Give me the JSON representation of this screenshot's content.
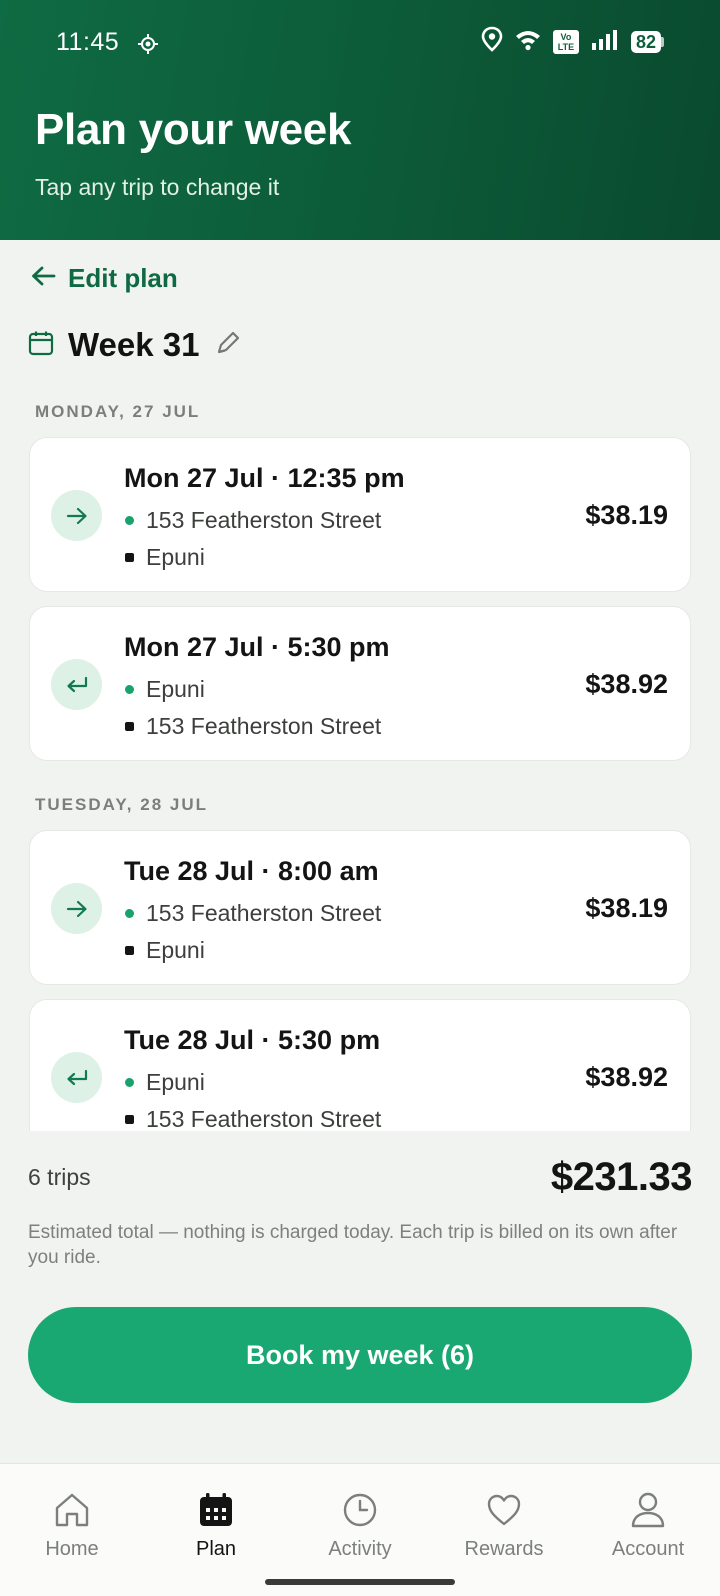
{
  "status_bar": {
    "time": "11:45",
    "battery": "82"
  },
  "header": {
    "title": "Plan your week",
    "subtitle": "Tap any trip to change it"
  },
  "back_link": {
    "label": "Edit plan"
  },
  "week": {
    "label": "Week 31"
  },
  "days": [
    {
      "heading": "MONDAY, 27 JUL"
    },
    {
      "heading": "TUESDAY, 28 JUL"
    }
  ],
  "trips": [
    {
      "when": "Mon 27 Jul · 12:35 pm",
      "from": "153 Featherston Street",
      "to": "Epuni",
      "price": "$38.19",
      "direction": "outbound"
    },
    {
      "when": "Mon 27 Jul · 5:30 pm",
      "from": "Epuni",
      "to": "153 Featherston Street",
      "price": "$38.92",
      "direction": "return"
    },
    {
      "when": "Tue 28 Jul · 8:00 am",
      "from": "153 Featherston Street",
      "to": "Epuni",
      "price": "$38.19",
      "direction": "outbound"
    },
    {
      "when": "Tue 28 Jul · 5:30 pm",
      "from": "Epuni",
      "to": "153 Featherston Street",
      "price": "$38.92",
      "direction": "return"
    }
  ],
  "summary": {
    "trip_count": "6 trips",
    "total": "$231.33",
    "note": "Estimated total — nothing is charged today. Each trip is billed on its own after you ride."
  },
  "cta": {
    "label": "Book my week (6)"
  },
  "nav": {
    "items": [
      {
        "label": "Home",
        "icon": "home-icon"
      },
      {
        "label": "Plan",
        "icon": "calendar-icon",
        "active": true
      },
      {
        "label": "Activity",
        "icon": "clock-icon"
      },
      {
        "label": "Rewards",
        "icon": "heart-icon"
      },
      {
        "label": "Account",
        "icon": "person-icon"
      }
    ]
  },
  "colors": {
    "header_bg": "#0c5a38",
    "accent": "#1aa872",
    "link": "#0e6a43",
    "origin_dot": "#19a26b",
    "destination_dot": "#141414"
  }
}
